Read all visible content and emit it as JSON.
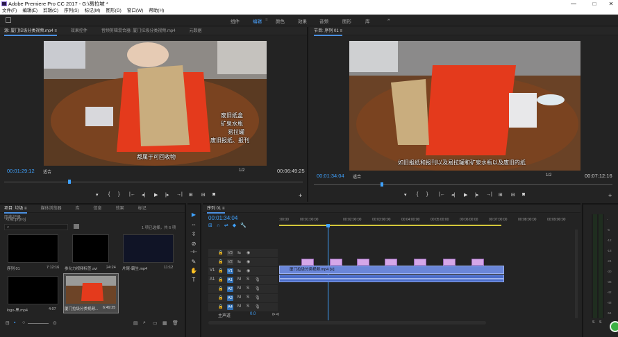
{
  "window": {
    "title": "Adobe Premiere Pro CC 2017 - G:\\易拉坡 *",
    "minimize": "—",
    "maximize": "□",
    "close": "✕"
  },
  "menu": [
    "文件(F)",
    "编辑(E)",
    "剪辑(C)",
    "序列(S)",
    "标记(M)",
    "图形(G)",
    "窗口(W)",
    "帮助(H)"
  ],
  "workspaces": [
    {
      "label": "组件",
      "active": false
    },
    {
      "label": "编辑",
      "active": true
    },
    {
      "label": "颜色",
      "active": false
    },
    {
      "label": "效果",
      "active": false
    },
    {
      "label": "音频",
      "active": false
    },
    {
      "label": "图形",
      "active": false
    },
    {
      "label": "库",
      "active": false
    }
  ],
  "workspaces_more": "»",
  "source": {
    "tabs": [
      "源: 厦门拉圾分类视频.mp4 ≡",
      "效果控件",
      "音频剪辑混合器: 厦门拉圾分类视频.mp4",
      "元数据"
    ],
    "subtitle": "都属于可回收物",
    "overlay_lines": [
      "废旧纸盒",
      "矿泉水瓶",
      "易拉罐",
      "废旧报纸、报刊"
    ],
    "timecode": "00:01:29:12",
    "fit": "适合",
    "ratio": "1/2",
    "duration": "00:06:49:25"
  },
  "program": {
    "tab": "节目: 序列 01 ≡",
    "subtitle": "如旧报纸和报刊以及易拉罐和矿泉水瓶以及废旧的纸",
    "timecode": "00:01:34:04",
    "fit": "适合",
    "ratio": "1/2",
    "duration": "00:07:12:16"
  },
  "controls": [
    "▾",
    "{",
    "}",
    "|←",
    "◂|",
    "▶",
    "|▸",
    "→|",
    "⊞",
    "⊟",
    "◙",
    "+"
  ],
  "project": {
    "tabs": [
      "项目: 垃圾 ≡",
      "媒体浏览器",
      "库",
      "信息",
      "效果",
      "标记",
      "历史记录"
    ],
    "file": "垃圾.prproj",
    "search_placeholder": "⌕",
    "selection": "1 项已选择，共 6 项",
    "items": [
      {
        "name": "序列 01",
        "duration": "7:12:16"
      },
      {
        "name": "参允力视频标签.avi",
        "duration": "24:24"
      },
      {
        "name": "片尾-霸生.mp4",
        "duration": "11:12"
      },
      {
        "name": "logo-黑.mp4",
        "duration": "4:07"
      },
      {
        "name": "厦门拉圾分类视频...",
        "duration": "6:49:25"
      }
    ]
  },
  "tools": [
    "▶",
    "⇔",
    "⇳",
    "⊘",
    "⊣⊢",
    "✎",
    "✋",
    "T"
  ],
  "timeline": {
    "tab": "序列 01 ≡",
    "timecode": "00:01:34:04",
    "ruler": [
      ":00:00",
      "00:01:00:00",
      "00:02:00:00",
      "00:03:00:00",
      "00:04:00:00",
      "00:05:00:00",
      "00:06:00:00",
      "00:07:00:00",
      "00:08:00:00",
      "00:09:00:00"
    ],
    "tracks": [
      {
        "name": "V3",
        "kind": "video"
      },
      {
        "name": "V2",
        "kind": "video"
      },
      {
        "name": "V1",
        "kind": "video"
      },
      {
        "name": "A1",
        "kind": "audio"
      },
      {
        "name": "A2",
        "kind": "audio"
      },
      {
        "name": "A3",
        "kind": "audio"
      },
      {
        "name": "A4",
        "kind": "audio"
      }
    ],
    "master": "主声道",
    "master_value": "0.0",
    "clip_label": "厦门拉圾分类视频.mp4 [V]"
  },
  "meters": {
    "labels": [
      "-",
      "-6",
      "-12",
      "-18",
      "-24",
      "-30",
      "-36",
      "-42",
      "-48",
      "-54"
    ],
    "bottom": [
      "S",
      "S"
    ]
  },
  "colors": {
    "accent": "#3fa2ff",
    "video_clip": "#4a6cc8",
    "audio_clip": "#4a6cc8",
    "overlay_clip": "#d5a7e8"
  }
}
